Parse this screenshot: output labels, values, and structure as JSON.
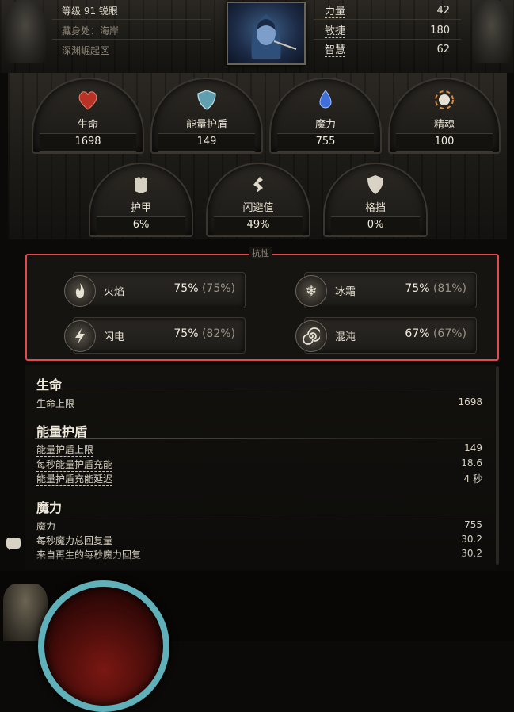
{
  "header": {
    "level_class": "等级 91 锐眼",
    "hideout": "藏身处：海岸",
    "zone": "深渊崛起区"
  },
  "attributes": [
    {
      "name": "力量",
      "value": "42"
    },
    {
      "name": "敏捷",
      "value": "180"
    },
    {
      "name": "智慧",
      "value": "62"
    }
  ],
  "pools": [
    {
      "name": "生命",
      "value": "1698",
      "icon": "heart-icon"
    },
    {
      "name": "能量护盾",
      "value": "149",
      "icon": "shield-icon"
    },
    {
      "name": "魔力",
      "value": "755",
      "icon": "mana-icon"
    },
    {
      "name": "精魂",
      "value": "100",
      "icon": "spirit-icon"
    }
  ],
  "defences": [
    {
      "name": "护甲",
      "value": "6%",
      "icon": "armour-icon"
    },
    {
      "name": "闪避值",
      "value": "49%",
      "icon": "evasion-icon"
    },
    {
      "name": "格挡",
      "value": "0%",
      "icon": "block-icon"
    }
  ],
  "resistances": {
    "title": "抗性",
    "items": [
      {
        "name": "火焰",
        "value": "75%",
        "max": "(75%)",
        "icon": "fire-icon"
      },
      {
        "name": "冰霜",
        "value": "75%",
        "max": "(81%)",
        "icon": "cold-icon"
      },
      {
        "name": "闪电",
        "value": "75%",
        "max": "(82%)",
        "icon": "lightning-icon"
      },
      {
        "name": "混沌",
        "value": "67%",
        "max": "(67%)",
        "icon": "chaos-icon"
      }
    ]
  },
  "stats": {
    "life": {
      "title": "生命",
      "lines": [
        {
          "label": "生命上限",
          "value": "1698"
        }
      ]
    },
    "es": {
      "title": "能量护盾",
      "lines": [
        {
          "label": "能量护盾上限",
          "value": "149"
        },
        {
          "label": "每秒能量护盾充能",
          "value": "18.6"
        },
        {
          "label": "能量护盾充能延迟",
          "value": "4 秒"
        }
      ]
    },
    "mana": {
      "title": "魔力",
      "lines": [
        {
          "label": "魔力",
          "value": "755"
        },
        {
          "label": "每秒魔力总回复量",
          "value": "30.2"
        },
        {
          "label": "来自再生的每秒魔力回复",
          "value": "30.2"
        }
      ]
    }
  },
  "colors": {
    "highlight": "#e5484d",
    "life": "#c0392b",
    "energy_shield": "#7ab8c8",
    "mana": "#3f6fd8"
  }
}
